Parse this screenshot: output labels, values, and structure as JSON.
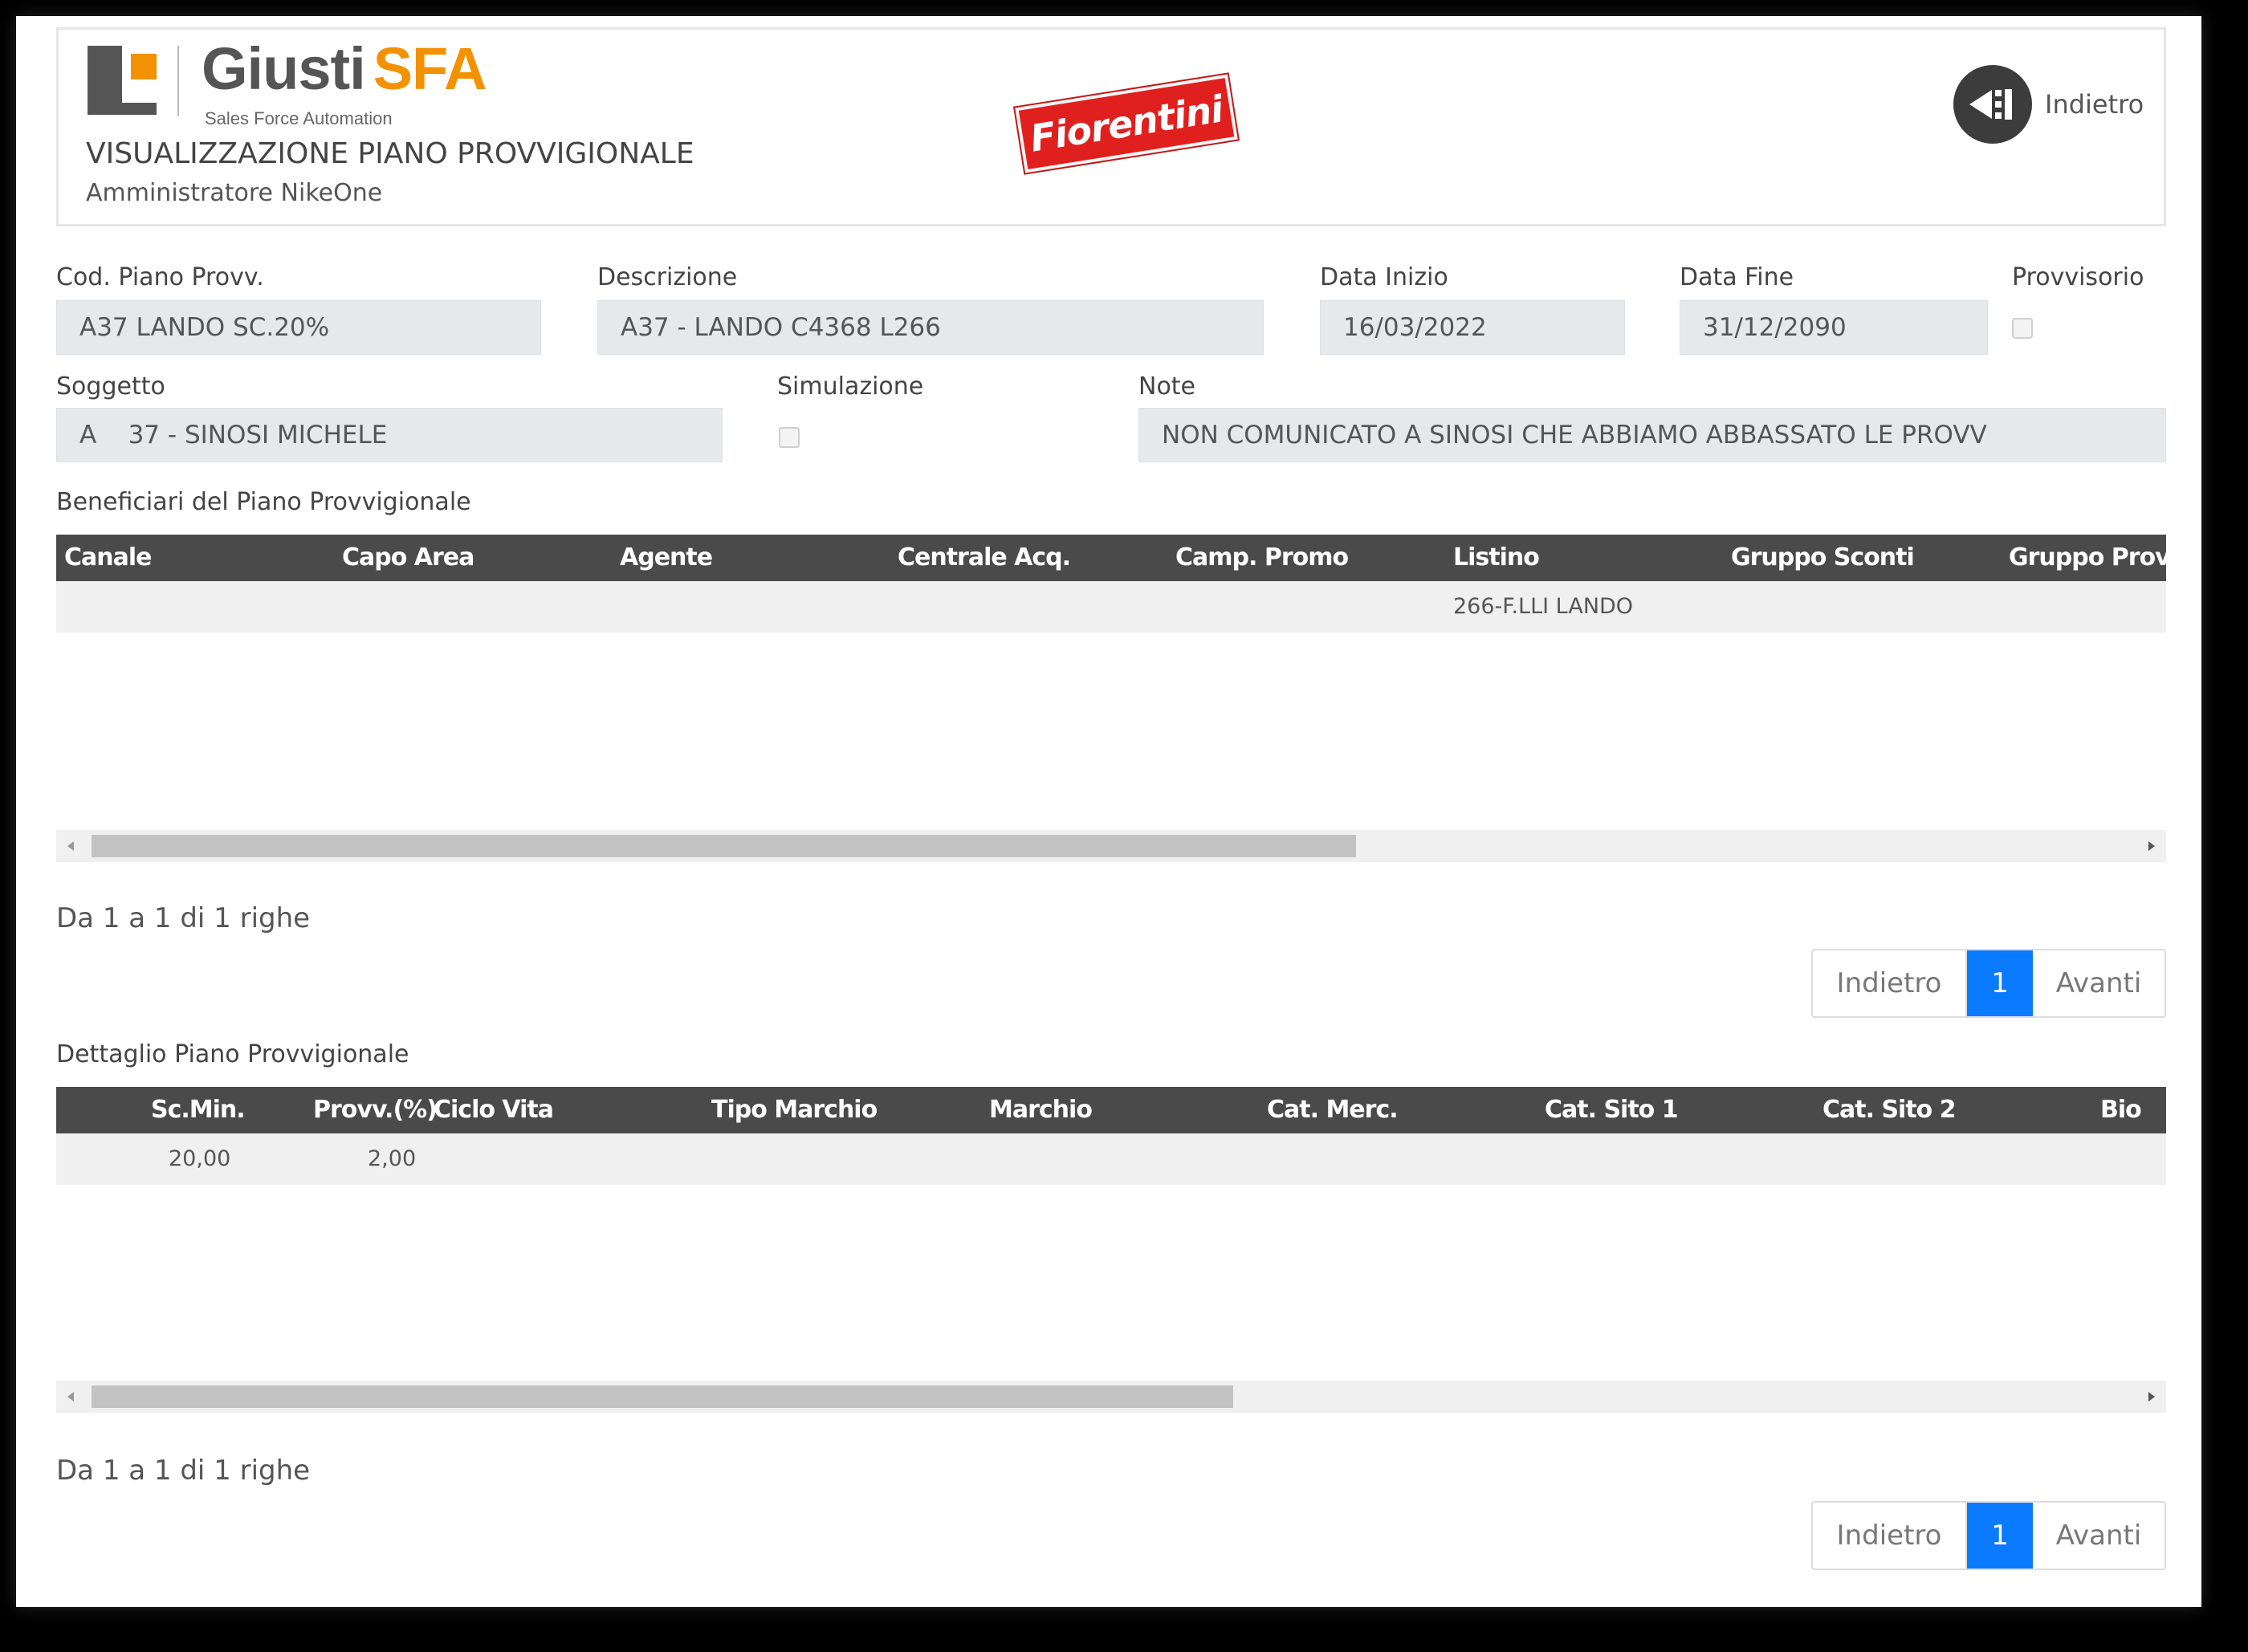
{
  "brand": {
    "name_a": "Giusti",
    "name_b": "SFA",
    "subtitle": "Sales Force Automation"
  },
  "header": {
    "title": "VISUALIZZAZIONE PIANO PROVVIGIONALE",
    "user": "Amministratore NikeOne",
    "customer_logo": "Fiorentini",
    "back_label": "Indietro",
    "back_icon": "back-arrow-icon"
  },
  "form": {
    "cod_label": "Cod. Piano Provv.",
    "cod_value": "A37 LANDO SC.20%",
    "desc_label": "Descrizione",
    "desc_value": "A37 - LANDO C4368 L266",
    "data_inizio_label": "Data Inizio",
    "data_inizio_value": "16/03/2022",
    "data_fine_label": "Data Fine",
    "data_fine_value": "31/12/2090",
    "provvisorio_label": "Provvisorio",
    "provvisorio_checked": false,
    "soggetto_label": "Soggetto",
    "soggetto_value": "A    37 - SINOSI MICHELE",
    "simulazione_label": "Simulazione",
    "simulazione_checked": false,
    "note_label": "Note",
    "note_value": "NON COMUNICATO A SINOSI CHE ABBIAMO ABBASSATO LE PROVV"
  },
  "beneficiari": {
    "title": "Beneficiari del Piano Provvigionale",
    "columns": [
      "Canale",
      "Capo Area",
      "Agente",
      "Centrale Acq.",
      "Camp. Promo",
      "Listino",
      "Gruppo Sconti",
      "Gruppo Provv."
    ],
    "rows": [
      [
        "",
        "",
        "",
        "",
        "",
        "266-F.LLI LANDO",
        "",
        ""
      ]
    ],
    "scroll_fraction": 0.62,
    "row_info": "Da 1 a 1 di 1 righe",
    "pager": {
      "prev": "Indietro",
      "current": "1",
      "next": "Avanti"
    }
  },
  "dettaglio": {
    "title": "Dettaglio Piano Provvigionale",
    "columns": [
      "Sc.Min.",
      "Provv.(%)",
      "Ciclo Vita",
      "Tipo Marchio",
      "Marchio",
      "Cat. Merc.",
      "Cat. Sito 1",
      "Cat. Sito 2",
      "Bio"
    ],
    "rows": [
      [
        "20,00",
        "2,00",
        "",
        "",
        "",
        "",
        "",
        "",
        ""
      ]
    ],
    "scroll_fraction": 0.56,
    "row_info": "Da 1 a 1 di 1 righe",
    "pager": {
      "prev": "Indietro",
      "current": "1",
      "next": "Avanti"
    }
  },
  "colors": {
    "accent": "#f39200",
    "pager_active": "#0a7bff",
    "grid_header": "#4a4a4a",
    "logo_red": "#e0201e"
  }
}
